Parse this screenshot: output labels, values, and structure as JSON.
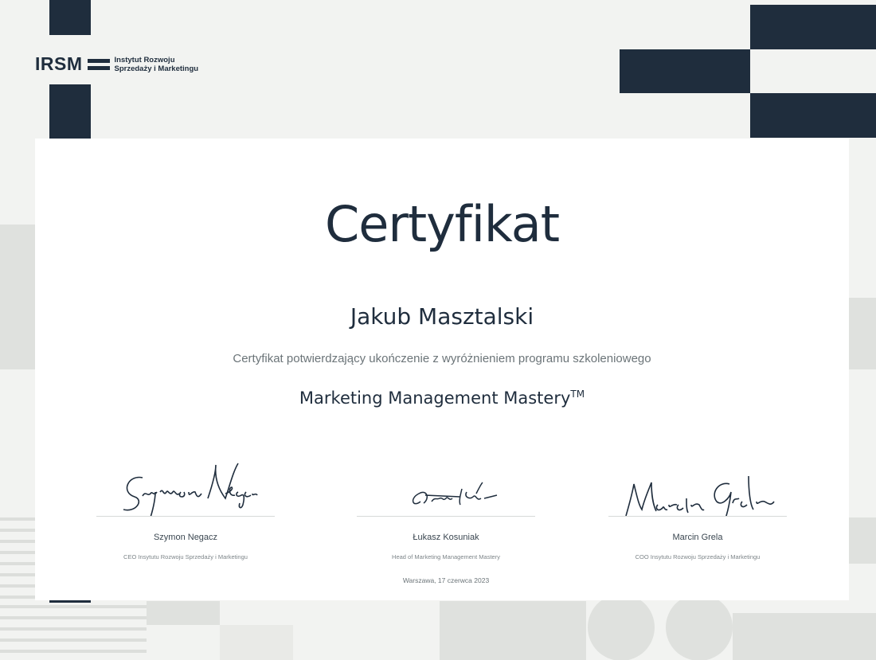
{
  "logo": {
    "mark": "IRSM",
    "line1": "Instytut Rozwoju",
    "line2": "Sprzedaży i Marketingu"
  },
  "certificate": {
    "title": "Certyfikat",
    "recipient": "Jakub Masztalski",
    "description": "Certyfikat potwierdzający ukończenie z wyróżnieniem programu szkoleniowego",
    "program": "Marketing Management Mastery",
    "program_mark": "TM",
    "place_date": "Warszawa, 17 czerwca 2023"
  },
  "signatories": [
    {
      "name": "Szymon Negacz",
      "role": "CEO Insytutu Rozwoju Sprzedaży i Marketingu"
    },
    {
      "name": "Łukasz Kosuniak",
      "role": "Head of Marketing Management Mastery"
    },
    {
      "name": "Marcin Grela",
      "role": "COO Insytutu Rozwoju Sprzedaży i Marketingu"
    }
  ],
  "colors": {
    "navy": "#1f2d3d",
    "background": "#f2f3f1",
    "card": "#ffffff"
  }
}
